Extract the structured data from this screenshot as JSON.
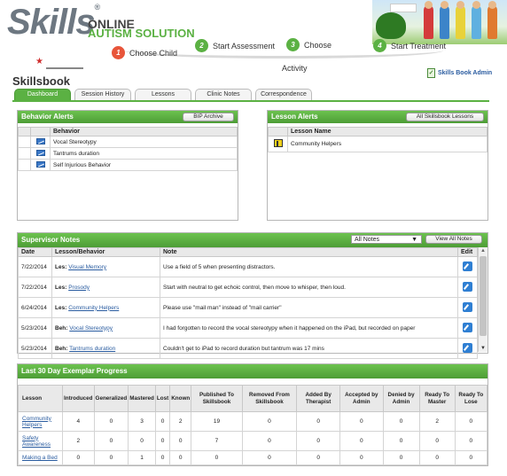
{
  "brand": {
    "logo": "Skills",
    "reg_mark": "®",
    "line1": "ONLINE",
    "line2": "AUTISM SOLUTION"
  },
  "steps": [
    {
      "num": "1",
      "label": "Choose Child",
      "color": "#e8553a"
    },
    {
      "num": "2",
      "label": "Start Assessment",
      "color": "#5bb143"
    },
    {
      "num": "3",
      "label": "Choose",
      "label2": "Activity",
      "color": "#5bb143"
    },
    {
      "num": "4",
      "label": "Start Treatment",
      "color": "#5bb143"
    }
  ],
  "page_title": "Skillsbook",
  "admin_link": "Skills Book Admin",
  "tabs": [
    "Dashboard",
    "Session History",
    "Lessons",
    "Clinic Notes",
    "Correspondence"
  ],
  "behavior_alerts": {
    "title": "Behavior Alerts",
    "button": "BIP Archive",
    "col": "Behavior",
    "rows": [
      "Vocal Stereotypy",
      "Tantrums duration",
      "Self Injurious Behavior"
    ]
  },
  "lesson_alerts": {
    "title": "Lesson Alerts",
    "button": "All Skillsbook Lessons",
    "col": "Lesson Name",
    "rows": [
      "Community Helpers"
    ]
  },
  "supervisor_notes": {
    "title": "Supervisor Notes",
    "filter": "All Notes",
    "filter_arrow": "▼",
    "button": "View All Notes",
    "cols": [
      "Date",
      "Lesson/Behavior",
      "Note",
      "Edit"
    ],
    "rows": [
      {
        "date": "7/22/2014",
        "type": "Les:",
        "item": "Visual Memory",
        "note": "Use a field of 5 when presenting distractors."
      },
      {
        "date": "7/22/2014",
        "type": "Les:",
        "item": "Prosody",
        "note": "Start with neutral to get echoic control, then move to whisper, then loud."
      },
      {
        "date": "6/24/2014",
        "type": "Les:",
        "item": "Community Helpers",
        "note": "Please use \"mail man\" instead of \"mail carrier\""
      },
      {
        "date": "5/23/2014",
        "type": "Beh:",
        "item": "Vocal Stereotypy",
        "note": "I had forgotten to record the vocal stereotypy when it happened on the iPad, but recorded on paper"
      },
      {
        "date": "5/23/2014",
        "type": "Beh:",
        "item": "Tantrums duration",
        "note": "Couldn't get to iPad to record duration but tantrum was 17 mins"
      }
    ]
  },
  "progress": {
    "title": "Last 30 Day Exemplar Progress",
    "cols": [
      "Lesson",
      "Introduced",
      "Generalized",
      "Mastered",
      "Lost",
      "Known",
      "Published To Skillsbook",
      "Removed From Skillsbook",
      "Added By Therapist",
      "Accepted by Admin",
      "Denied by Admin",
      "Ready To Master",
      "Ready To Lose"
    ],
    "rows": [
      {
        "lesson": "Community Helpers",
        "vals": [
          "4",
          "0",
          "3",
          "0",
          "2",
          "19",
          "0",
          "0",
          "0",
          "0",
          "2",
          "0"
        ]
      },
      {
        "lesson": "Safety Awareness",
        "vals": [
          "2",
          "0",
          "0",
          "0",
          "0",
          "7",
          "0",
          "0",
          "0",
          "0",
          "0",
          "0"
        ]
      },
      {
        "lesson": "Making a Bed",
        "vals": [
          "0",
          "0",
          "1",
          "0",
          "0",
          "0",
          "0",
          "0",
          "0",
          "0",
          "0",
          "0"
        ]
      }
    ]
  }
}
